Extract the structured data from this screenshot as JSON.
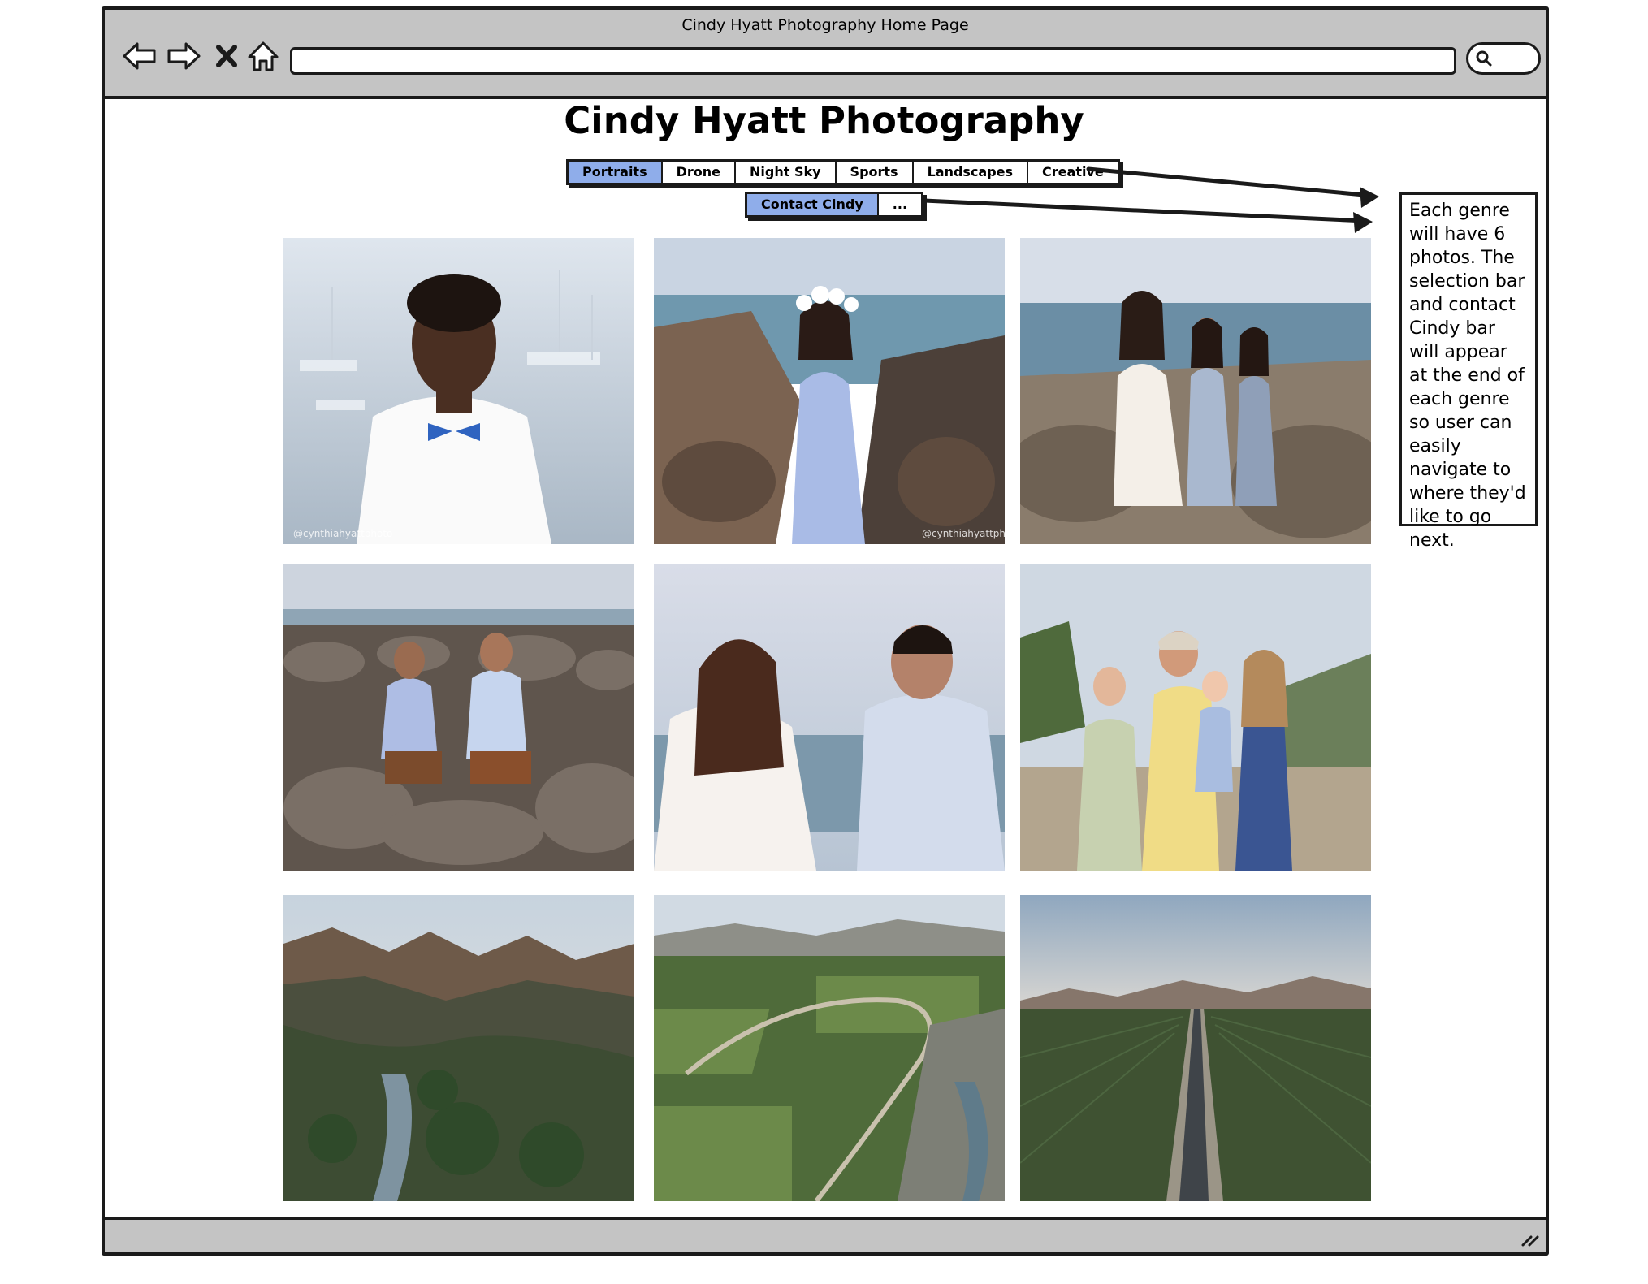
{
  "window": {
    "title": "Cindy Hyatt Photography Home Page"
  },
  "browser": {
    "back_icon": "back-arrow-icon",
    "forward_icon": "forward-arrow-icon",
    "stop_icon": "close-icon",
    "home_icon": "home-icon",
    "url": "",
    "search_icon": "search-icon"
  },
  "page": {
    "title": "Cindy Hyatt Photography"
  },
  "nav": {
    "tabs": [
      {
        "label": "Portraits",
        "active": true
      },
      {
        "label": "Drone",
        "active": false
      },
      {
        "label": "Night Sky",
        "active": false
      },
      {
        "label": "Sports",
        "active": false
      },
      {
        "label": "Landscapes",
        "active": false
      },
      {
        "label": "Creative",
        "active": false
      }
    ]
  },
  "contact_bar": {
    "tabs": [
      {
        "label": "Contact Cindy",
        "active": true
      },
      {
        "label": "...",
        "active": false
      }
    ]
  },
  "photos": [
    {
      "subject": "portrait of smiling man with blue bow tie by the harbor",
      "watermark": "@cynthiahyattphoto"
    },
    {
      "subject": "maternity portrait with flower crown on coastal rocks",
      "watermark": "@cynthiahyattphoto"
    },
    {
      "subject": "mother and two daughters sitting on coastal rocks",
      "watermark": ""
    },
    {
      "subject": "two men sitting on rocks by the ocean",
      "watermark": ""
    },
    {
      "subject": "couple facing each other by the sea",
      "watermark": ""
    },
    {
      "subject": "family of four on a hilltop",
      "watermark": ""
    },
    {
      "subject": "aerial view of mountains and river valley",
      "watermark": ""
    },
    {
      "subject": "aerial view of vineyard and river",
      "watermark": ""
    },
    {
      "subject": "aerial view of road through vineyards",
      "watermark": ""
    }
  ],
  "annotation": {
    "text": "Each genre will have 6 photos. The selection bar and contact Cindy bar will appear at the end of each genre so user can easily navigate to where they'd like to go next."
  },
  "colors": {
    "chrome": "#c4c4c4",
    "active_tab": "#8fadea",
    "outline": "#1a1a1a"
  }
}
